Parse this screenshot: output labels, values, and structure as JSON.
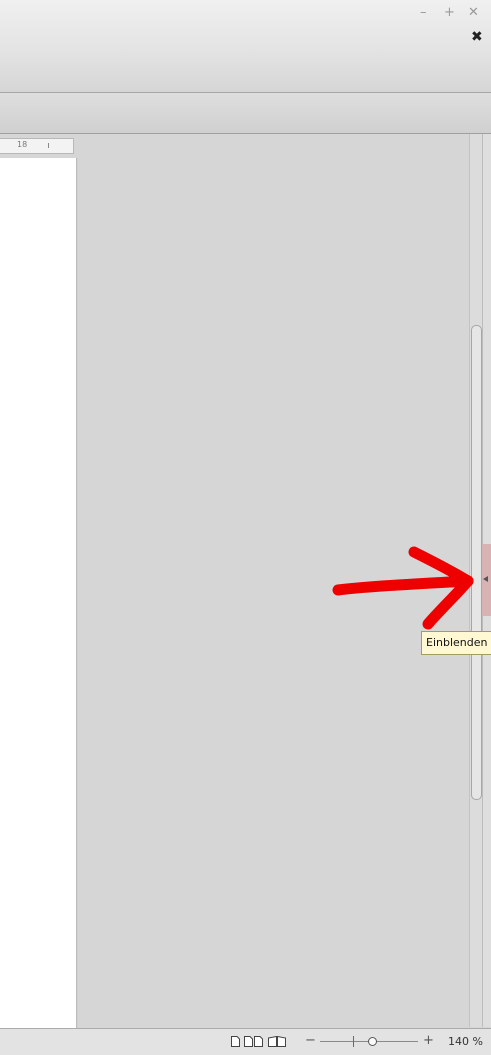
{
  "window": {
    "minimize_glyph": "–",
    "maximize_glyph": "+",
    "close_glyph": "✕",
    "doc_close_glyph": "✖"
  },
  "ruler": {
    "number": "18"
  },
  "sidebar": {
    "toggle_icon": "left-triangle-icon",
    "accent_color": "#d8b3b3"
  },
  "tooltip": {
    "text": "Einblenden"
  },
  "annotation": {
    "color": "#ee0000",
    "icon": "red-arrow-annotation"
  },
  "statusbar": {
    "view_modes": [
      "single-page-view-icon",
      "two-page-view-icon",
      "book-view-icon"
    ],
    "zoom_minus": "−",
    "zoom_plus": "+",
    "zoom_label": "140 %"
  }
}
